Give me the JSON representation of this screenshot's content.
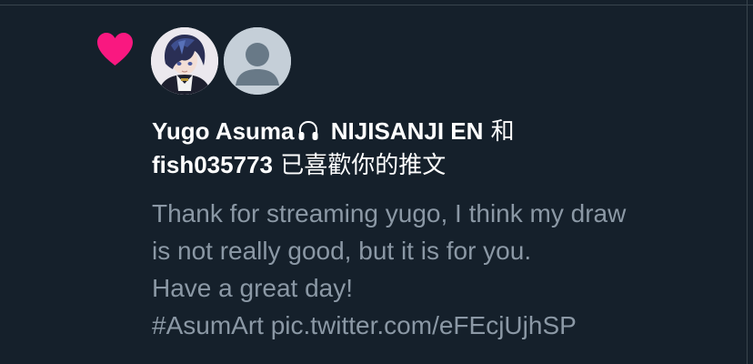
{
  "notification": {
    "actor_1_name": "Yugo Asuma",
    "actor_1_suffix": "NIJISANJI EN",
    "conjunction": "和",
    "actor_2_name": "fish035773",
    "action_text": "已喜歡你的推文",
    "tweet_lines": [
      "Thank for streaming yugo, I think my draw",
      "is not really good, but it is for you.",
      "Have a great day!",
      "#AsumArt pic.twitter.com/eFEcjUjhSP"
    ],
    "icons": {
      "like": "heart-icon",
      "actor_1_badge": "headphones-icon",
      "actor_1_avatar": "anime-avatar",
      "actor_2_avatar": "default-profile-avatar"
    },
    "colors": {
      "background": "#15202b",
      "heart": "#f91880",
      "primary_text": "#ffffff",
      "secondary_text": "#8b98a5"
    }
  }
}
